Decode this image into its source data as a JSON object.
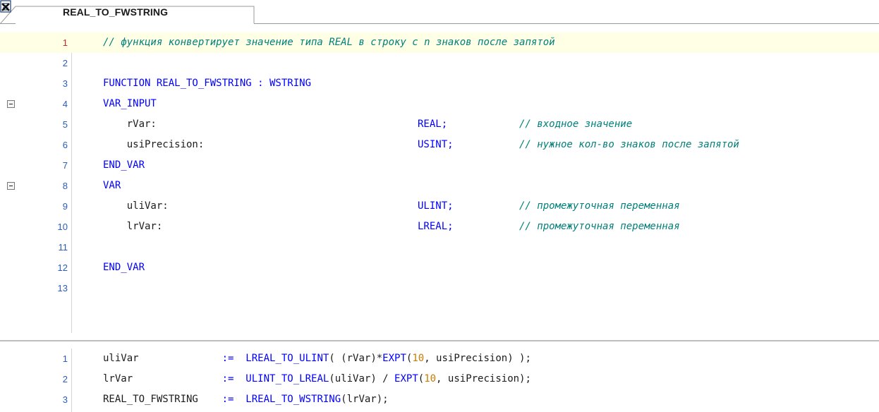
{
  "tab": {
    "title": "REAL_TO_FWSTRING",
    "icon": "document-icon",
    "close_icon": "close-icon"
  },
  "decl": {
    "lines": [
      {
        "n": "1",
        "parts": [
          [
            "cm",
            "// функция конвертирует значение типа REAL в строку с n знаков после запятой"
          ]
        ]
      },
      {
        "n": "2",
        "parts": []
      },
      {
        "n": "3",
        "parts": [
          [
            "kw",
            "FUNCTION REAL_TO_FWSTRING : WSTRING"
          ]
        ]
      },
      {
        "n": "4",
        "parts": [
          [
            "kw",
            "VAR_INPUT"
          ]
        ]
      },
      {
        "n": "5",
        "parts": [
          [
            "id",
            "    rVar:"
          ],
          [
            "kw",
            "REAL;"
          ],
          [
            "cm",
            "// входное значение"
          ]
        ]
      },
      {
        "n": "6",
        "parts": [
          [
            "id",
            "    usiPrecision:"
          ],
          [
            "kw",
            "USINT;"
          ],
          [
            "cm",
            "// нужное кол-во знаков после запятой"
          ]
        ]
      },
      {
        "n": "7",
        "parts": [
          [
            "kw",
            "END_VAR"
          ]
        ]
      },
      {
        "n": "8",
        "parts": [
          [
            "kw",
            "VAR"
          ]
        ]
      },
      {
        "n": "9",
        "parts": [
          [
            "id",
            "    uliVar:"
          ],
          [
            "kw",
            "ULINT;"
          ],
          [
            "cm",
            "// промежуточная переменная"
          ]
        ]
      },
      {
        "n": "10",
        "parts": [
          [
            "id",
            "    lrVar:"
          ],
          [
            "kw",
            "LREAL;"
          ],
          [
            "cm",
            "// промежуточная переменная"
          ]
        ]
      },
      {
        "n": "11",
        "parts": []
      },
      {
        "n": "12",
        "parts": [
          [
            "kw",
            "END_VAR"
          ]
        ]
      },
      {
        "n": "13",
        "parts": []
      }
    ]
  },
  "impl": {
    "lines": [
      {
        "n": "1",
        "text": "uliVar              :=  LREAL_TO_ULINT( (rVar)*EXPT(10, usiPrecision) );"
      },
      {
        "n": "2",
        "text": "lrVar               :=  ULINT_TO_LREAL(uliVar) / EXPT(10, usiPrecision);"
      },
      {
        "n": "3",
        "text": "REAL_TO_FWSTRING    :=  LREAL_TO_WSTRING(lrVar);"
      }
    ]
  }
}
